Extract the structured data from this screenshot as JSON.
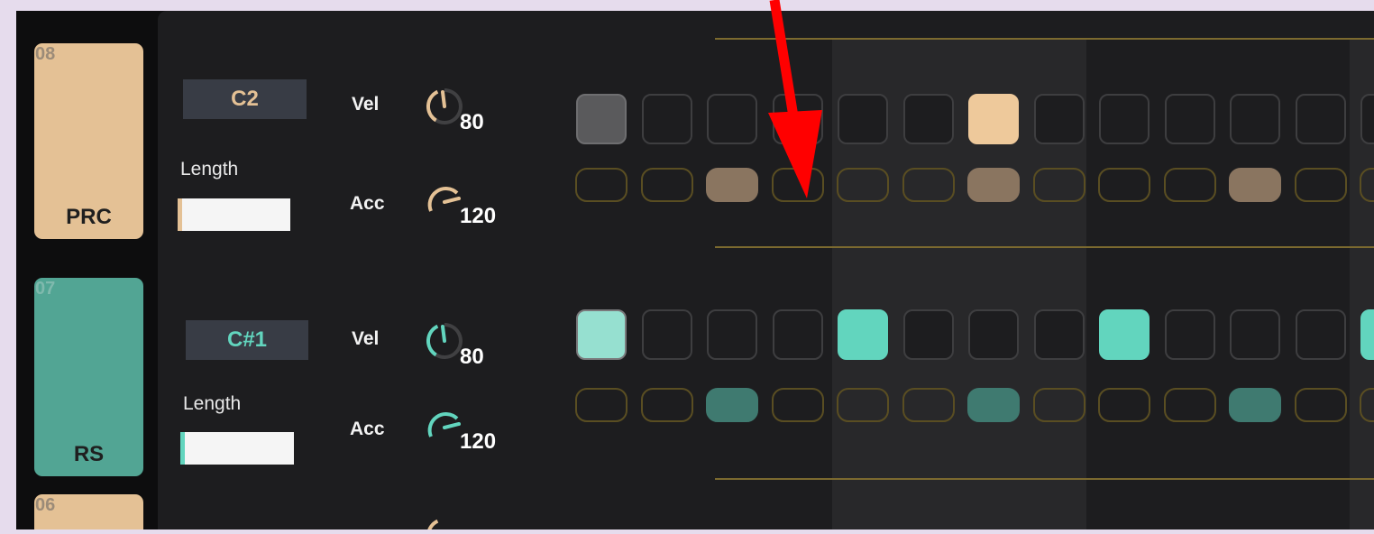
{
  "colors": {
    "prc": "#e4c195",
    "rs": "#52a594",
    "prc_pad_on": "#eec99b",
    "prc_acc_on": "#8a7560",
    "rs_pad_on": "#62d5be",
    "rs_pad_first": "#96e0d0",
    "rs_acc_on": "#3f7a70",
    "pad_current": "#5a5a5c",
    "annotation": "#ff0000"
  },
  "tracks": [
    {
      "number": "08",
      "name": "PRC",
      "note": "C2",
      "length_label": "Length",
      "vel_label": "Vel",
      "vel_value": "80",
      "acc_label": "Acc",
      "acc_value": "120",
      "pads": [
        2,
        0,
        0,
        0,
        0,
        0,
        1,
        0,
        0,
        0,
        0,
        0,
        0
      ],
      "accents": [
        0,
        0,
        1,
        0,
        0,
        0,
        1,
        0,
        0,
        0,
        1,
        0,
        0
      ]
    },
    {
      "number": "07",
      "name": "RS",
      "note": "C#1",
      "length_label": "Length",
      "vel_label": "Vel",
      "vel_value": "80",
      "acc_label": "Acc",
      "acc_value": "120",
      "pads": [
        3,
        0,
        0,
        0,
        1,
        0,
        0,
        0,
        1,
        0,
        0,
        0,
        1
      ],
      "accents": [
        0,
        0,
        1,
        0,
        0,
        0,
        1,
        0,
        0,
        0,
        1,
        0,
        0
      ]
    },
    {
      "number": "06"
    }
  ]
}
